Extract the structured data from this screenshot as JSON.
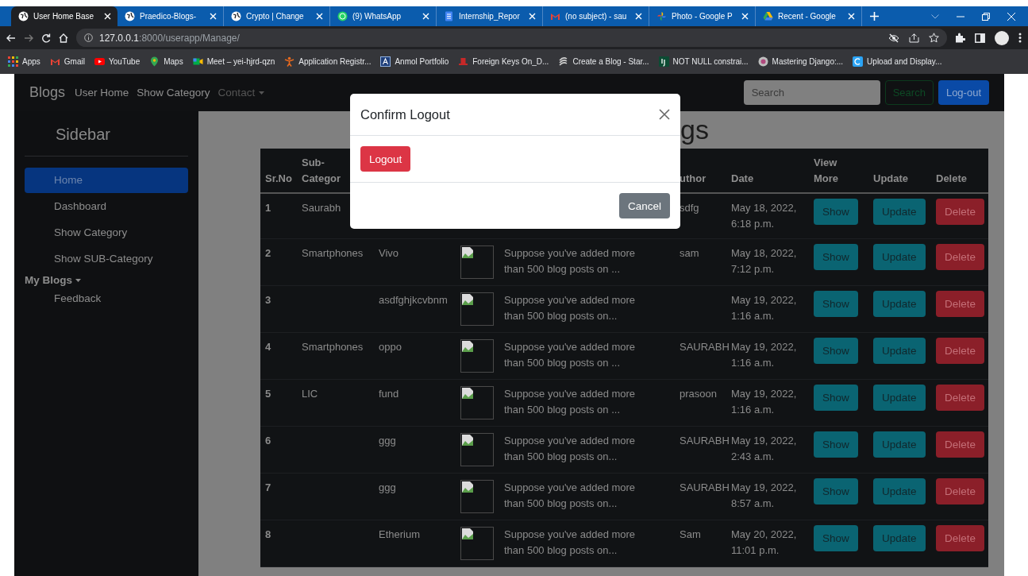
{
  "browser": {
    "tabs": [
      {
        "title": "User Home Base",
        "selected": true
      },
      {
        "title": "Praedico-Blogs-",
        "selected": false
      },
      {
        "title": "Crypto | Change",
        "selected": false
      },
      {
        "title": "(9) WhatsApp",
        "selected": false
      },
      {
        "title": "Internship_Repor",
        "selected": false
      },
      {
        "title": "(no subject) - sau",
        "selected": false
      },
      {
        "title": "Photo - Google P",
        "selected": false
      },
      {
        "title": "Recent - Google",
        "selected": false
      }
    ],
    "address": {
      "host": "127.0.0.1",
      "path": ":8000/userapp/Manage/"
    },
    "bookmarks": [
      {
        "label": "Apps"
      },
      {
        "label": "Gmail"
      },
      {
        "label": "YouTube"
      },
      {
        "label": "Maps"
      },
      {
        "label": "Meet – yei-hjrd-qzn"
      },
      {
        "label": "Application Registr..."
      },
      {
        "label": "Anmol Portfolio"
      },
      {
        "label": "Foreign Keys On_D..."
      },
      {
        "label": "Create a Blog - Star..."
      },
      {
        "label": "NOT NULL constrai..."
      },
      {
        "label": "Mastering Django:..."
      },
      {
        "label": "Upload and Display..."
      }
    ]
  },
  "navbar": {
    "brand": "Blogs",
    "links": [
      {
        "label": "User Home",
        "dropdown": false,
        "muted": false
      },
      {
        "label": "Show Category",
        "dropdown": false,
        "muted": false
      },
      {
        "label": "Contact",
        "dropdown": true,
        "muted": true
      }
    ],
    "search": {
      "placeholder": "Search"
    },
    "search_button": "Search",
    "logout_button": "Log-out"
  },
  "sidebar": {
    "title": "Sidebar",
    "items": [
      {
        "label": "Home",
        "kind": "link",
        "selected": true
      },
      {
        "label": "Dashboard",
        "kind": "link",
        "selected": false
      },
      {
        "label": "Show Category",
        "kind": "link",
        "selected": false
      },
      {
        "label": "Show SUB-Category",
        "kind": "link",
        "selected": false
      },
      {
        "label": "My Blogs",
        "kind": "dropdown",
        "children": [
          {
            "label": "Feedback",
            "kind": "link",
            "selected": false
          }
        ]
      }
    ]
  },
  "page": {
    "heading": "gs"
  },
  "table": {
    "columns": [
      {
        "label": "Sr.No"
      },
      {
        "label": "Sub-Categor"
      },
      {},
      {},
      {},
      {
        "label": "uthor"
      },
      {
        "label": "Date"
      },
      {
        "label": "View More"
      },
      {
        "label": "Update"
      },
      {
        "label": "Delete"
      }
    ],
    "rows": [
      {
        "sr": "1",
        "sub_category": "Saurabh",
        "author": "sdfg",
        "date": "May 18, 2022, 6:18 p.m.",
        "show": "Show",
        "update": "Update",
        "delete": "Delete"
      },
      {
        "sr": "2",
        "sub_category": "Smartphones",
        "category": "Vivo",
        "image": true,
        "excerpt": "Suppose you've added more than 500 blog posts on ...",
        "author": "sam",
        "date": "May 18, 2022, 7:12 p.m.",
        "show": "Show",
        "update": "Update",
        "delete": "Delete"
      },
      {
        "sr": "3",
        "category": "asdfghjkcvbnm",
        "image": true,
        "excerpt": "Suppose you've added more than 500 blog posts on...",
        "date": "May 19, 2022, 1:16 a.m.",
        "show": "Show",
        "update": "Update",
        "delete": "Delete"
      },
      {
        "sr": "4",
        "sub_category": "Smartphones",
        "category": "oppo",
        "image": true,
        "excerpt": "Suppose you've added more than 500 blog posts on ...",
        "author": "SAURABH",
        "date": "May 19, 2022, 1:16 a.m.",
        "show": "Show",
        "update": "Update",
        "delete": "Delete"
      },
      {
        "sr": "5",
        "sub_category": "LIC",
        "category": "fund",
        "image": true,
        "excerpt": "Suppose you've added more than 500 blog posts on ...",
        "author": "prasoon",
        "date": "May 19, 2022, 1:16 a.m.",
        "show": "Show",
        "update": "Update",
        "delete": "Delete"
      },
      {
        "sr": "6",
        "category": "ggg",
        "image": true,
        "excerpt": "Suppose you've added more than 500 blog posts on...",
        "author": "SAURABH",
        "date": "May 19, 2022, 2:43 a.m.",
        "show": "Show",
        "update": "Update",
        "delete": "Delete"
      },
      {
        "sr": "7",
        "category": "ggg",
        "image": true,
        "excerpt": "Suppose you've added more than 500 blog posts on...",
        "author": "SAURABH",
        "date": "May 19, 2022, 8:57 a.m.",
        "show": "Show",
        "update": "Update",
        "delete": "Delete"
      },
      {
        "sr": "8",
        "category": "Etherium",
        "image": true,
        "excerpt": "Suppose you've added more than 500 blog posts on...",
        "author": "Sam",
        "date": "May 20, 2022, 11:01 p.m.",
        "show": "Show",
        "update": "Update",
        "delete": "Delete"
      }
    ]
  },
  "modal": {
    "title": "Confirm Logout",
    "confirm_button": "Logout",
    "cancel_button": "Cancel"
  }
}
